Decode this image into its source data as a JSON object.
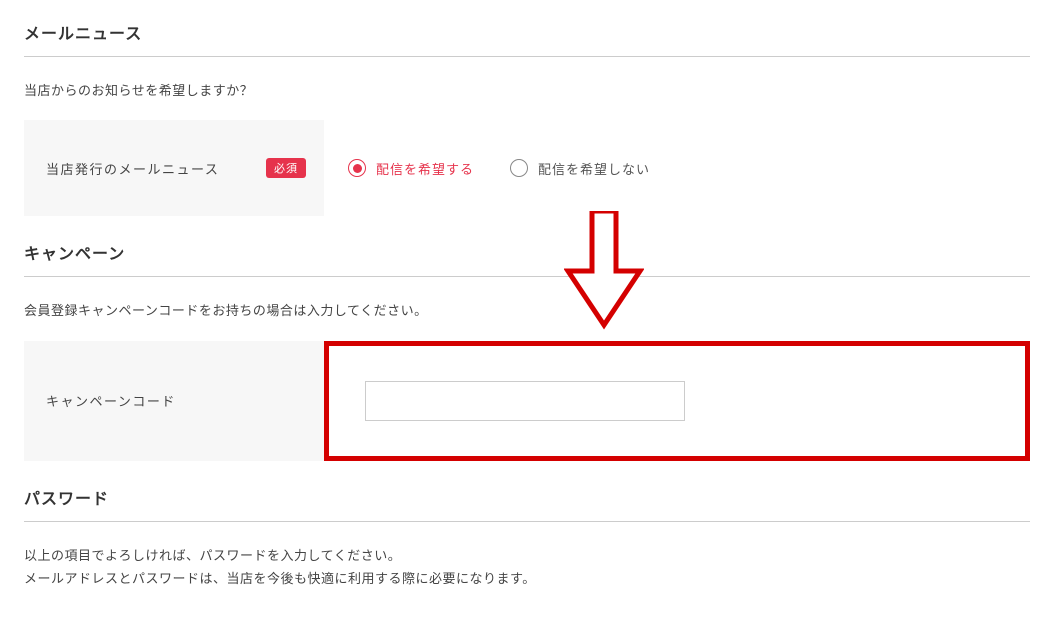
{
  "mail_news": {
    "title": "メールニュース",
    "description": "当店からのお知らせを希望しますか？",
    "field_label": "当店発行のメールニュース",
    "required_badge": "必須",
    "options": {
      "subscribe": "配信を希望する",
      "unsubscribe": "配信を希望しない"
    }
  },
  "campaign": {
    "title": "キャンペーン",
    "description": "会員登録キャンペーンコードをお持ちの場合は入力してください。",
    "field_label": "キャンペーンコード"
  },
  "password": {
    "title": "パスワード",
    "description_line1": "以上の項目でよろしければ、パスワードを入力してください。",
    "description_line2": "メールアドレスとパスワードは、当店を今後も快適に利用する際に必要になります。"
  },
  "colors": {
    "accent": "#e6334c",
    "highlight_border": "#d40000"
  }
}
